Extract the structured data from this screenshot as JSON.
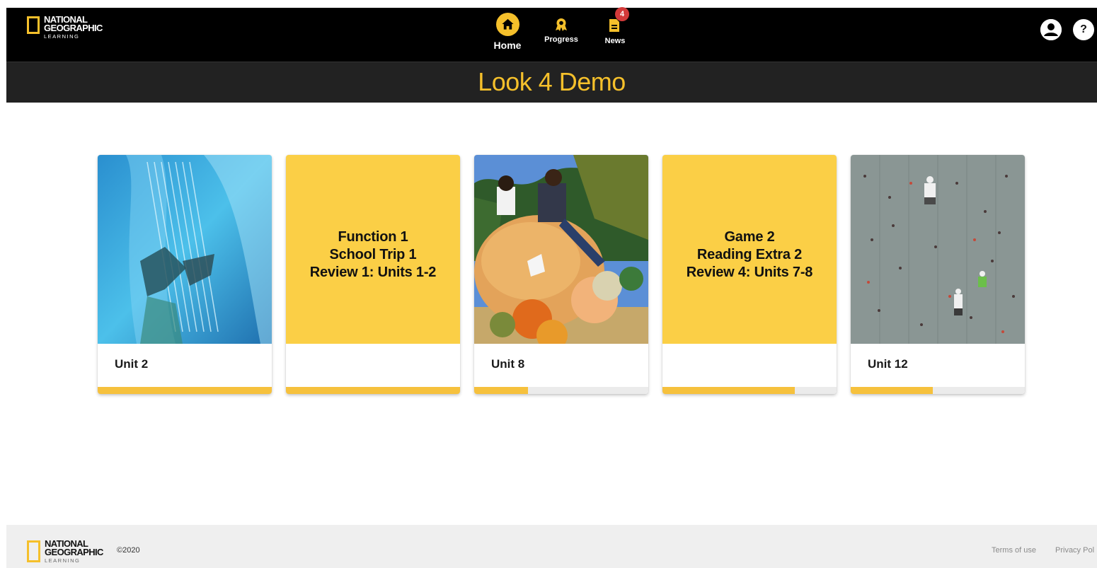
{
  "brand": {
    "logo_line1": "NATIONAL",
    "logo_line2": "GEOGRAPHIC",
    "logo_line3": "LEARNING",
    "accent_color": "#f5c02b"
  },
  "nav": {
    "home_label": "Home",
    "progress_label": "Progress",
    "news_label": "News",
    "news_badge": "4",
    "active": "Home",
    "icons": [
      "home-icon",
      "ribbon-icon",
      "news-icon",
      "user-icon",
      "help-icon"
    ],
    "help_glyph": "?"
  },
  "page": {
    "title": "Look 4 Demo"
  },
  "cards": [
    {
      "type": "image",
      "image": "harp-photo",
      "label": "Unit 2",
      "progress": 1.0
    },
    {
      "type": "text",
      "lines": [
        "Function 1",
        "School Trip 1",
        "Review 1: Units 1-2"
      ],
      "label": "",
      "progress": 1.0
    },
    {
      "type": "image",
      "image": "pumpkins-photo",
      "label": "Unit 8",
      "progress": 0.31
    },
    {
      "type": "text",
      "lines": [
        "Game 2",
        "Reading Extra 2",
        "Review 4: Units 7-8"
      ],
      "label": "",
      "progress": 0.76
    },
    {
      "type": "image",
      "image": "climbing-wall-photo",
      "label": "Unit 12",
      "progress": 0.47
    }
  ],
  "footer": {
    "copyright": "©2020",
    "terms": "Terms of use",
    "privacy": "Privacy Pol"
  }
}
